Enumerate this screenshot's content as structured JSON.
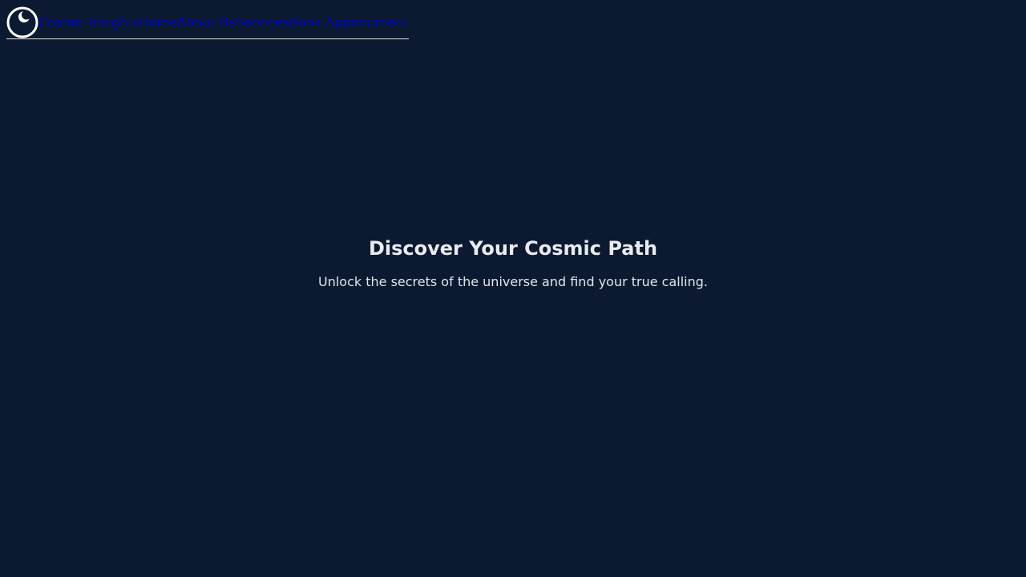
{
  "nav": {
    "logo_icon": "crescent-moon-icon",
    "brand": "Cosmic Insights",
    "links": [
      "Home",
      "About Us",
      "Services",
      "Book Appointment"
    ]
  },
  "hero": {
    "title": "Discover Your Cosmic Path",
    "subtitle": "Unlock the secrets of the universe and find your true calling."
  },
  "colors": {
    "background": "#0b1a30",
    "link": "#0000cc",
    "text": "#e9ebf0"
  }
}
